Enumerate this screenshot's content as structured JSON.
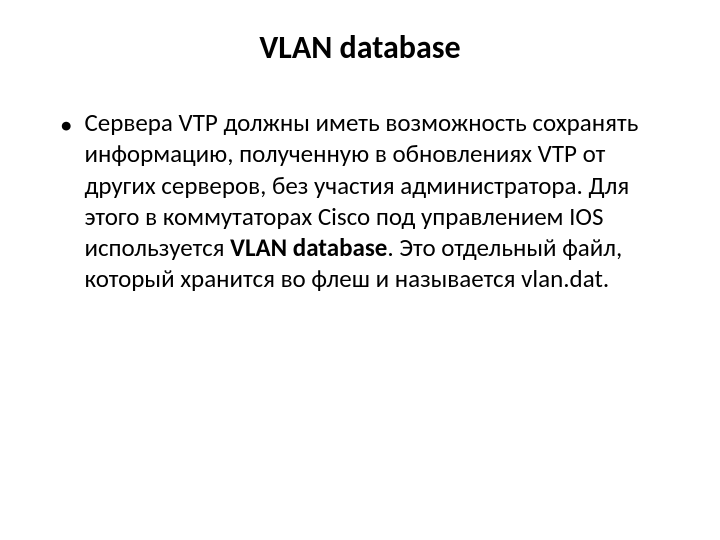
{
  "title": "VLAN database",
  "bullet": {
    "part1": "Сервера VTP должны иметь возможность сохранять информацию, полученную в обновлениях VTP от других серверов, без участия администратора. Для этого в коммутаторах Cisco под управлением IOS используется ",
    "bold": "VLAN database",
    "part2": ". Это отдельный файл, который хранится во флеш и называется vlan.dat."
  }
}
